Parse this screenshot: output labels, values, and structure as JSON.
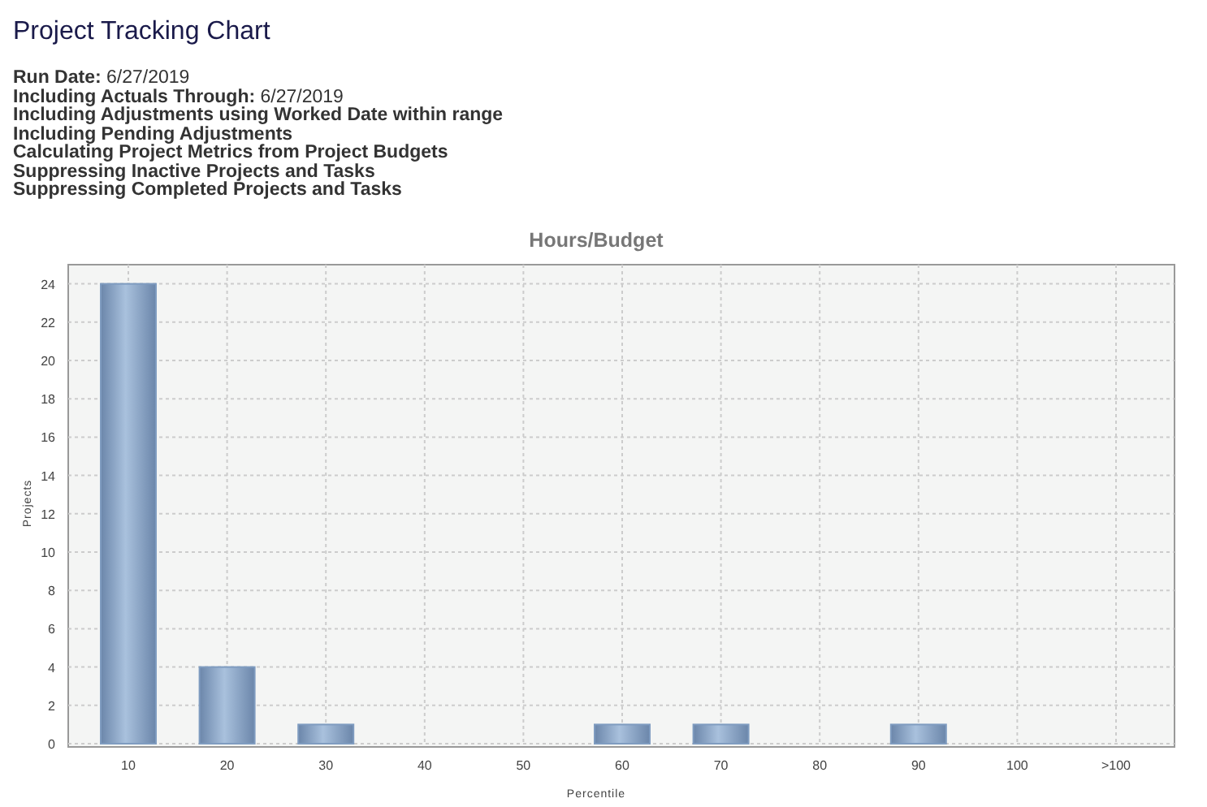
{
  "page": {
    "title": "Project Tracking Chart"
  },
  "report_options": [
    "**Run Date:** 6/27/2019",
    "**Including Actuals Through:** 6/27/2019",
    "Including Adjustments using Worked Date within range",
    "Including Pending Adjustments",
    "Calculating Project Metrics from Project Budgets",
    "Suppressing Inactive Projects and Tasks",
    "Suppressing Completed Projects and Tasks"
  ],
  "chart_data": {
    "type": "bar",
    "title": "Hours/Budget",
    "xlabel": "Percentile",
    "ylabel": "Projects",
    "categories": [
      "10",
      "20",
      "30",
      "40",
      "50",
      "60",
      "70",
      "80",
      "90",
      "100",
      ">100"
    ],
    "series": [
      {
        "color": "#7f9cc0",
        "values": [
          24,
          4,
          1,
          0,
          0,
          1,
          1,
          0,
          1,
          0,
          0
        ]
      }
    ],
    "grid": true,
    "ylim": [
      0,
      25
    ],
    "yticks": [
      0,
      2,
      4,
      6,
      8,
      10,
      12,
      14,
      16,
      18,
      20,
      22,
      24
    ]
  }
}
